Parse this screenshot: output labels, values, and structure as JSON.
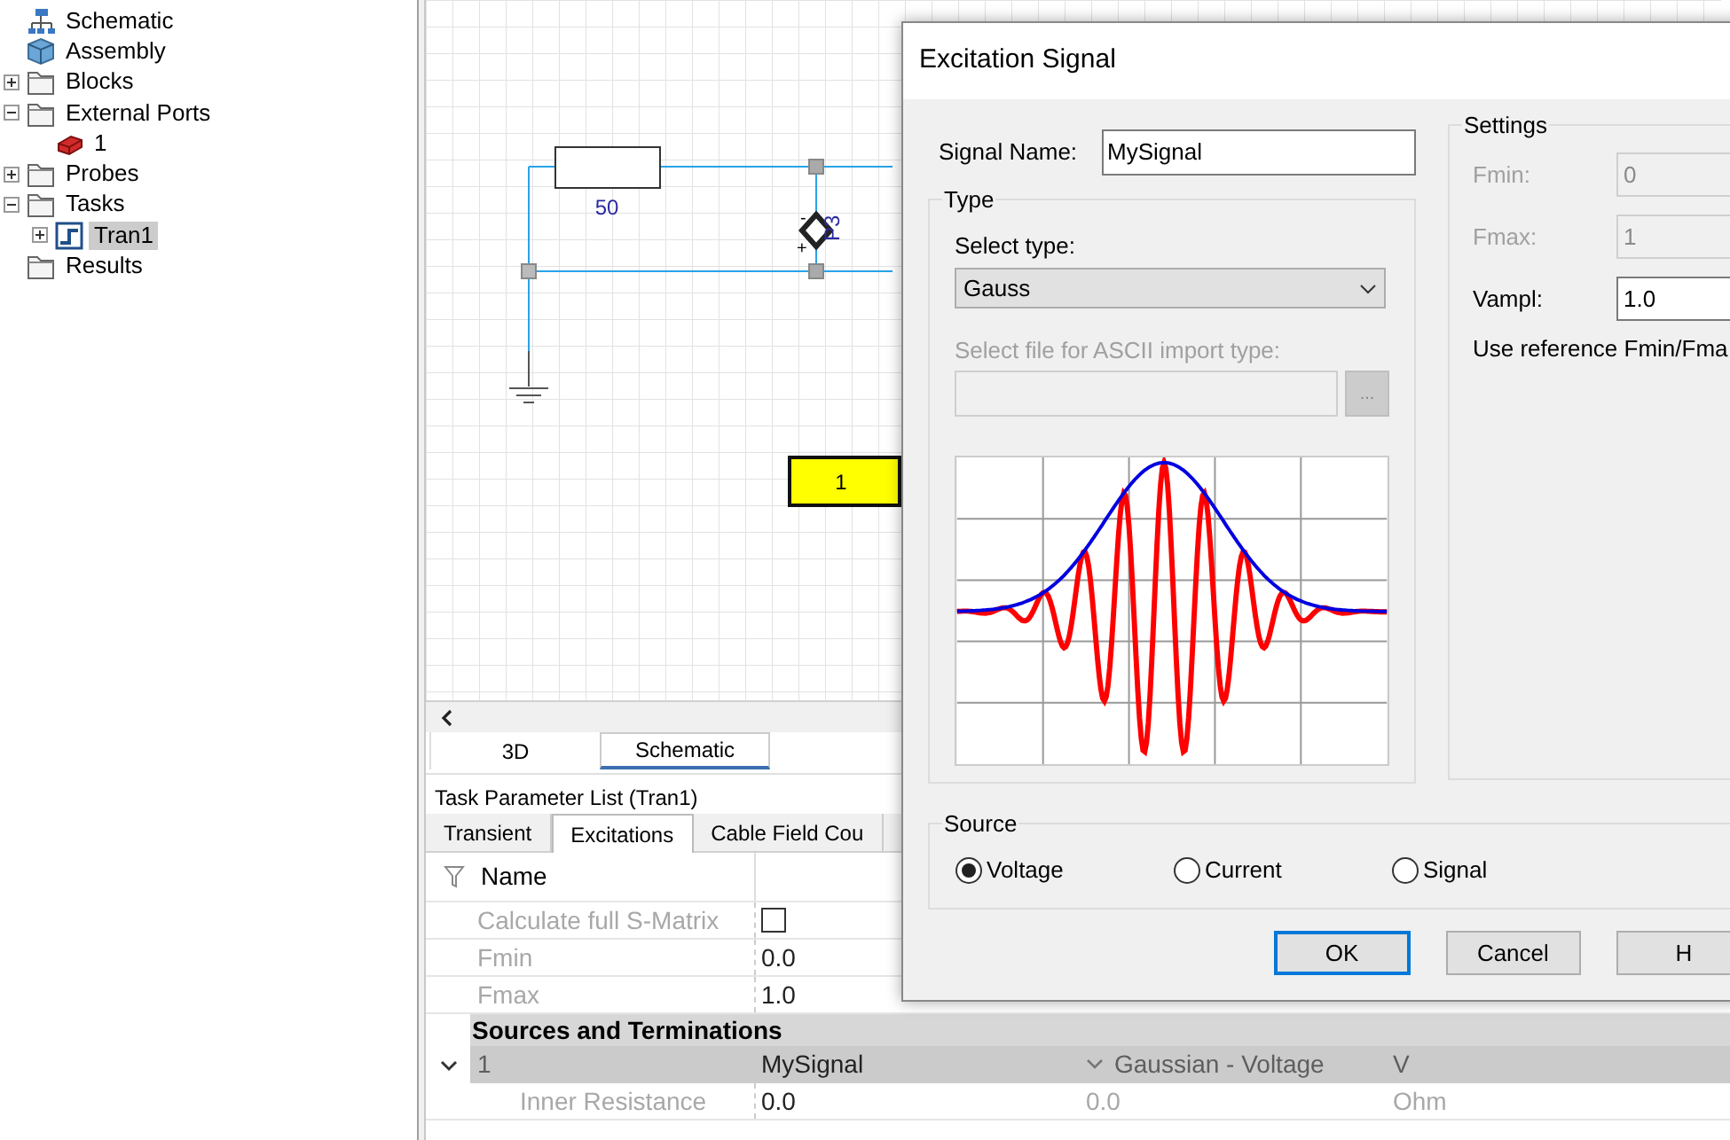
{
  "tree": [
    {
      "label": "Schematic",
      "kind": "schematic",
      "selected": false
    },
    {
      "label": "Assembly",
      "kind": "assembly",
      "selected": false
    },
    {
      "label": "Blocks",
      "kind": "folder",
      "expanded": false,
      "selected": false
    },
    {
      "label": "External Ports",
      "kind": "folder",
      "expanded": true,
      "selected": false,
      "children": [
        {
          "label": "1",
          "kind": "port",
          "selected": false
        }
      ]
    },
    {
      "label": "Probes",
      "kind": "folder",
      "expanded": false,
      "selected": false
    },
    {
      "label": "Tasks",
      "kind": "folder",
      "expanded": true,
      "selected": false,
      "children": [
        {
          "label": "Tran1",
          "kind": "task",
          "expanded": false,
          "selected": true
        }
      ]
    },
    {
      "label": "Results",
      "kind": "folder",
      "selected": false
    }
  ],
  "schematic": {
    "resistor_value": "50",
    "port_label": "P3",
    "port_minus": "-",
    "port_plus": "+",
    "block_label": "1"
  },
  "view_tabs": [
    {
      "label": "3D",
      "selected": false
    },
    {
      "label": "Schematic",
      "selected": true
    }
  ],
  "task_panel": {
    "title": "Task Parameter List (Tran1)",
    "tabs": [
      {
        "label": "Transient",
        "selected": false
      },
      {
        "label": "Excitations",
        "selected": true
      },
      {
        "label": "Cable Field Cou",
        "selected": false
      }
    ],
    "header": "Name",
    "rows": [
      {
        "kind": "checkbox",
        "name": "Calculate full S-Matrix",
        "checked": false,
        "disabled": true
      },
      {
        "kind": "value",
        "name": "Fmin",
        "value": "0.0",
        "disabled": true
      },
      {
        "kind": "value",
        "name": "Fmax",
        "value": "1.0",
        "disabled": true
      },
      {
        "kind": "section",
        "name": "Sources and Terminations"
      },
      {
        "kind": "group",
        "name": "1",
        "expanded": true,
        "value": "MySignal",
        "column_3": "Gaussian - Voltage",
        "column_4": "V"
      },
      {
        "kind": "sub",
        "name": "Inner Resistance",
        "value": "0.0",
        "column_3": "0.0",
        "column_4": "Ohm",
        "disabled": true
      }
    ]
  },
  "dialog": {
    "title": "Excitation Signal",
    "signal_name_label": "Signal Name:",
    "signal_name": "MySignal",
    "type_group": {
      "title": "Type",
      "select_label": "Select type:",
      "select_value": "Gauss",
      "file_label": "Select file for ASCII import type:",
      "file_disabled": true,
      "browse_label": "..."
    },
    "settings": {
      "title": "Settings",
      "fields": [
        {
          "label": "Fmin:",
          "value": "0",
          "disabled": true
        },
        {
          "label": "Fmax:",
          "value": "1",
          "disabled": true
        },
        {
          "label": "Vampl:",
          "value": "1.0",
          "disabled": false
        }
      ],
      "note": "Use reference Fmin/Fma"
    },
    "source": {
      "title": "Source",
      "options": [
        {
          "label": "Voltage",
          "selected": true
        },
        {
          "label": "Current",
          "selected": false
        },
        {
          "label": "Signal",
          "selected": false
        }
      ]
    },
    "buttons": [
      {
        "label": "OK",
        "default": true
      },
      {
        "label": "Cancel",
        "default": false
      },
      {
        "label": "H",
        "default": false
      }
    ]
  }
}
